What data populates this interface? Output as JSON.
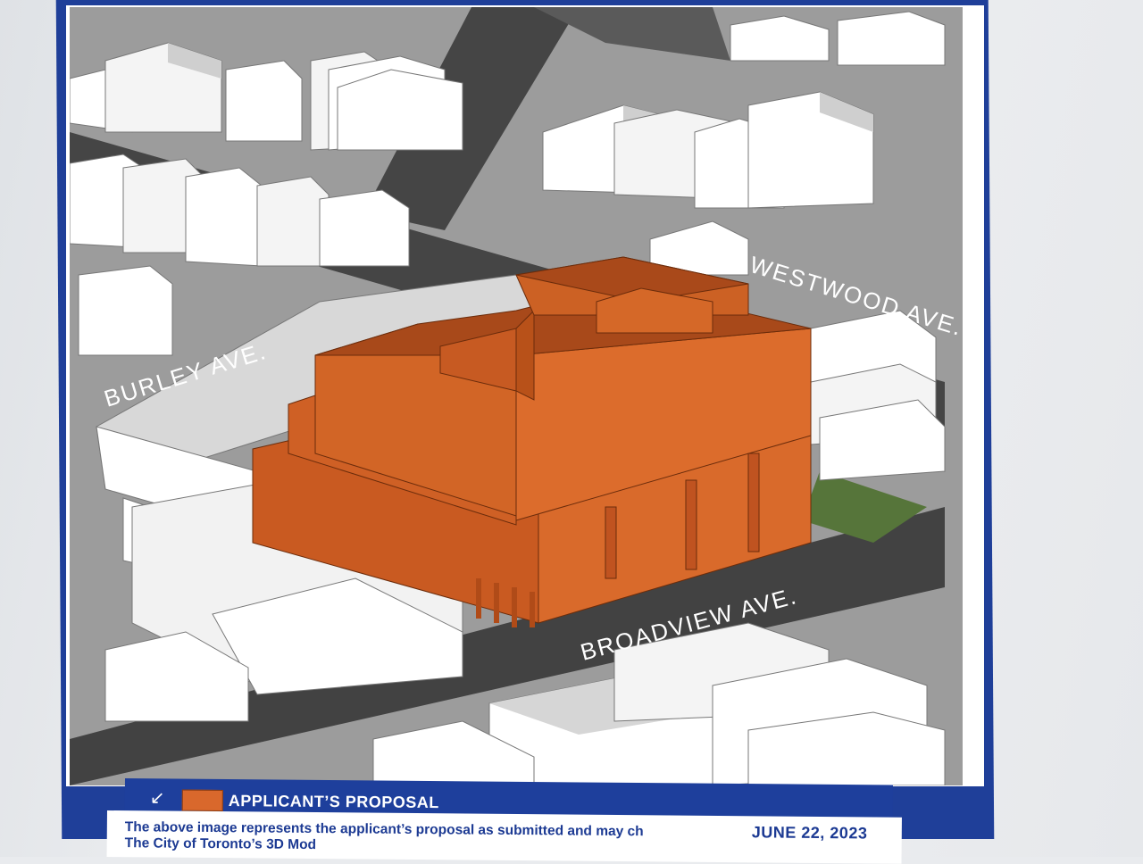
{
  "streets": {
    "burley": "BURLEY AVE.",
    "westwood": "WESTWOOD AVE.",
    "broadview": "BROADVIEW AVE."
  },
  "legend": {
    "arrow_icon": "north-arrow-icon",
    "label": "APPLICANT’S PROPOSAL",
    "swatch_color": "#d9682c"
  },
  "caption": {
    "line1": "The above image represents the applicant’s proposal as submitted and may ch",
    "line2": "The City of Toronto’s 3D Mod"
  },
  "date": "JUNE 22, 2023",
  "colors": {
    "proposal": "#d9682c",
    "road": "#4a4a4a",
    "ground": "#9c9c9c",
    "park": "#56753a",
    "border": "#1f3f99"
  }
}
